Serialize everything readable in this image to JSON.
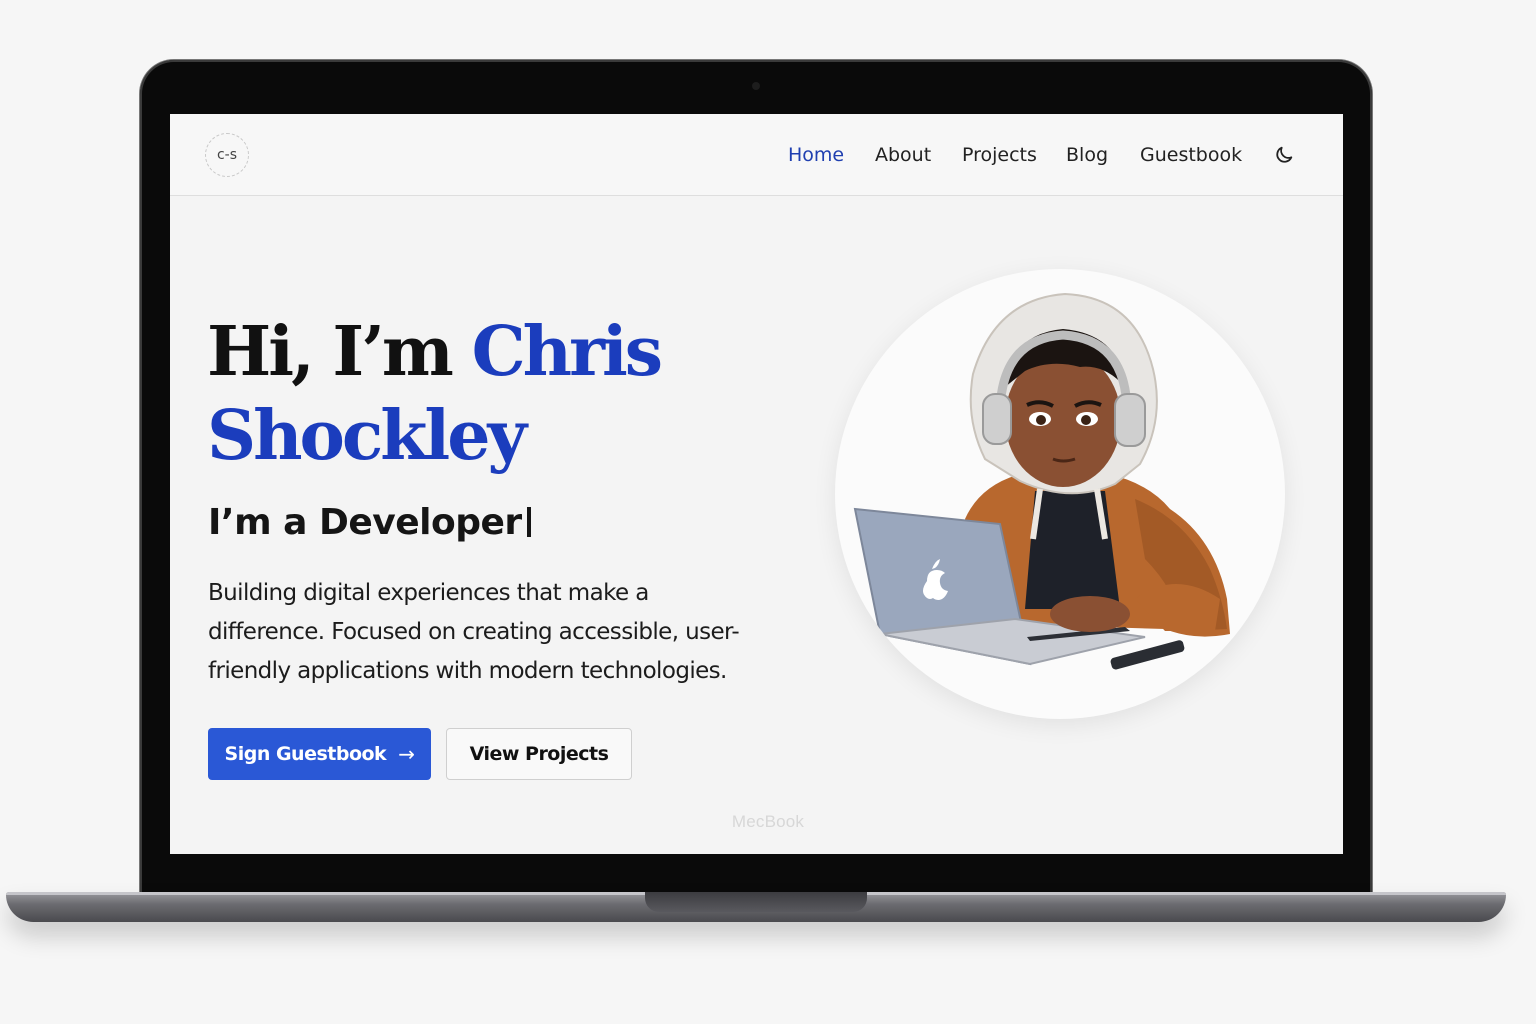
{
  "device": {
    "brand_label": "MecBook"
  },
  "site": {
    "logo_text": "c-s",
    "nav": [
      {
        "label": "Home",
        "active": true
      },
      {
        "label": "About",
        "active": false
      },
      {
        "label": "Projects",
        "active": false
      },
      {
        "label": "Blog",
        "active": false
      },
      {
        "label": "Guestbook",
        "active": false
      }
    ],
    "theme_toggle_icon": "moon-icon"
  },
  "hero": {
    "greeting": "Hi, I’m",
    "first_name": "Chris",
    "last_name": "Shockley",
    "role": "I’m a Developer",
    "tagline_lines": [
      "Building digital experiences that make a",
      "difference. Focused on creating accessible, user-",
      "friendly applications with modern technologies."
    ],
    "primary_button": "Sign Guestbook",
    "primary_button_icon": "arrow-right-icon",
    "secondary_button": "View Projects",
    "avatar_icon": "developer-avatar-illustration"
  },
  "colors": {
    "accent": "#1b3dbd",
    "button_primary": "#2a58d6",
    "nav_active": "#1f3fb0"
  }
}
